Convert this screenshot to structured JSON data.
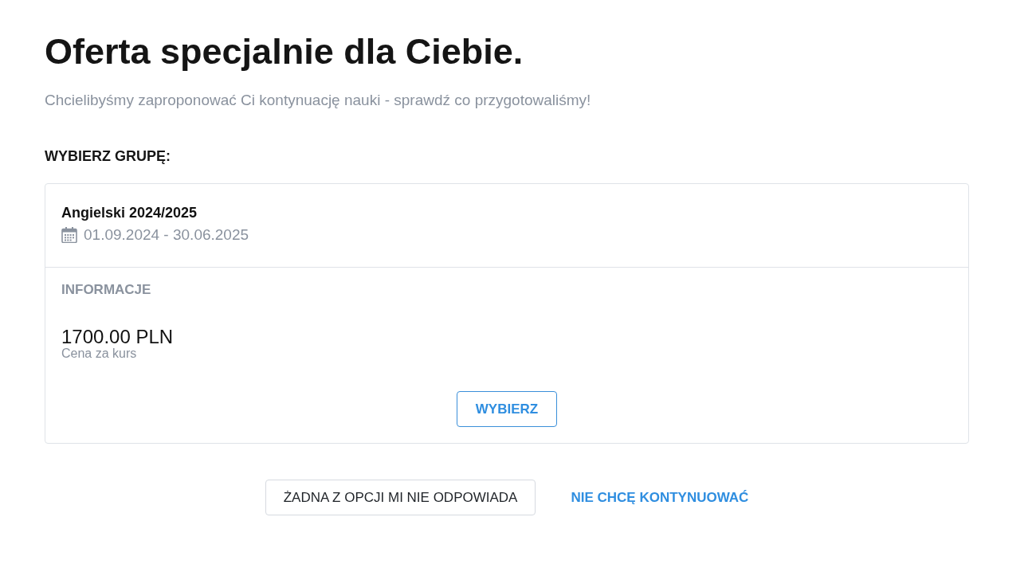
{
  "heading": "Oferta specjalnie dla Ciebie.",
  "subtitle": "Chcielibyśmy zaproponować Ci kontynuację nauki - sprawdź co przygotowaliśmy!",
  "section_label": "WYBIERZ GRUPĘ:",
  "groups": [
    {
      "name": "Angielski 2024/2025",
      "dates": "01.09.2024 - 30.06.2025",
      "info_label": "INFORMACJE",
      "price": "1700.00 PLN",
      "price_caption": "Cena za kurs",
      "button": "WYBIERZ"
    }
  ],
  "actions": [
    {
      "kind": "button",
      "label": "ŻADNA Z OPCJI MI NIE ODPOWIADA"
    },
    {
      "kind": "link",
      "label": "NIE CHCĘ KONTYNUOWAĆ"
    }
  ]
}
